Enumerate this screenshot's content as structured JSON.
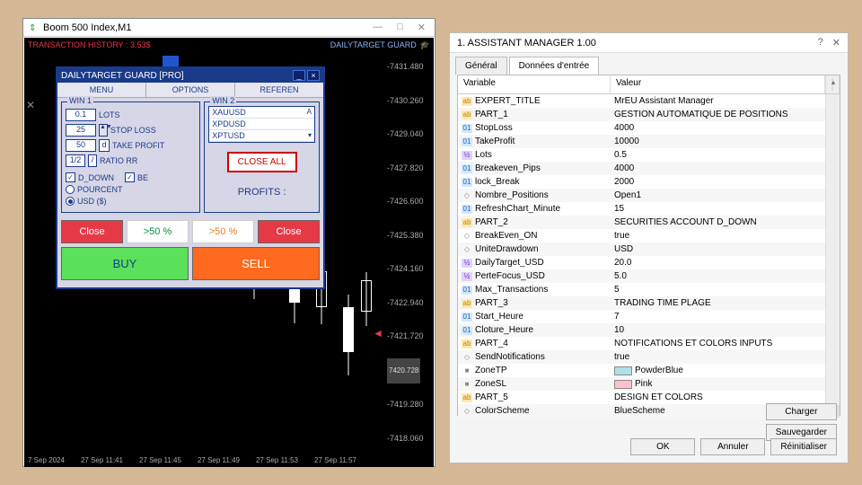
{
  "left": {
    "title": "Boom 500 Index,M1",
    "win_min": "—",
    "win_max": "□",
    "win_close": "✕",
    "history": "TRANSACTION HISTORY : 3.53$",
    "guard": "DAILYTARGET GUARD",
    "y_ticks": [
      "-7431.480",
      "-7430.260",
      "-7429.040",
      "-7427.820",
      "-7426.600",
      "-7425.380",
      "-7424.160",
      "-7422.940",
      "-7421.720",
      "7420.728",
      "-7419.280",
      "-7418.060"
    ],
    "x_ticks": [
      "7 Sep 2024",
      "27 Sep 11:41",
      "27 Sep 11:45",
      "27 Sep 11:49",
      "27 Sep 11:53",
      "27 Sep 11:57"
    ]
  },
  "panel": {
    "title": "DAILYTARGET GUARD [PRO]",
    "menu": [
      "MENU",
      "OPTIONS",
      "REFEREN"
    ],
    "win1": {
      "legend": "WIN 1",
      "lots_val": "0.1",
      "lots_lbl": "LOTS",
      "sl_val": "25",
      "sl_lbl": "STOP LOSS",
      "tp_val": "50",
      "tp_unit": "d",
      "tp_lbl": "TAKE PROFIT",
      "rr_val": "1/2",
      "rr_slash": "/",
      "rr_lbl": "RATIO RR",
      "chk_ddown": "D_DOWN",
      "chk_be": "BE",
      "rad_pc": "POURCENT",
      "rad_usd": "USD ($)"
    },
    "win2": {
      "legend": "WIN 2",
      "symbols": [
        "XAUUSD",
        "XPDUSD",
        "XPTUSD"
      ],
      "close_all": "CLOSE ALL",
      "profits": "PROFITS :"
    },
    "btns": {
      "close": "Close",
      "gt50": ">50 %",
      "gt50b": ">50 %",
      "close2": "Close",
      "buy": "BUY",
      "sell": "SELL"
    }
  },
  "right": {
    "title": "1. ASSISTANT MANAGER 1.00",
    "tabs": [
      "Général",
      "Données d'entrée"
    ],
    "cols": [
      "Variable",
      "Valeur"
    ],
    "rows": [
      {
        "t": "ab",
        "k": "EXPERT_TITLE",
        "v": "MrEU Assistant Manager"
      },
      {
        "t": "ab",
        "k": "PART_1",
        "v": "GESTION AUTOMATIQUE DE POSITIONS"
      },
      {
        "t": "01",
        "k": "StopLoss",
        "v": "4000"
      },
      {
        "t": "01",
        "k": "TakeProfit",
        "v": "10000"
      },
      {
        "t": "half",
        "k": "Lots",
        "v": "0.5"
      },
      {
        "t": "01",
        "k": "Breakeven_Pips",
        "v": "4000"
      },
      {
        "t": "01",
        "k": "lock_Break",
        "v": "2000"
      },
      {
        "t": "circle",
        "k": "Nombre_Positions",
        "v": "Open1"
      },
      {
        "t": "01",
        "k": "RefreshChart_Minute",
        "v": "15"
      },
      {
        "t": "ab",
        "k": "PART_2",
        "v": "SECURITIES ACCOUNT D_DOWN"
      },
      {
        "t": "circle",
        "k": "BreakEven_ON",
        "v": "true"
      },
      {
        "t": "circle",
        "k": "UniteDrawdown",
        "v": "USD"
      },
      {
        "t": "half",
        "k": "DailyTarget_USD",
        "v": "20.0"
      },
      {
        "t": "half",
        "k": "PerteFocus_USD",
        "v": "5.0"
      },
      {
        "t": "01",
        "k": "Max_Transactions",
        "v": "5"
      },
      {
        "t": "ab",
        "k": "PART_3",
        "v": "TRADING TIME PLAGE"
      },
      {
        "t": "01",
        "k": "Start_Heure",
        "v": "7"
      },
      {
        "t": "01",
        "k": "Cloture_Heure",
        "v": "10"
      },
      {
        "t": "ab",
        "k": "PART_4",
        "v": "NOTIFICATIONS ET COLORS INPUTS"
      },
      {
        "t": "circle",
        "k": "SendNotifications",
        "v": "true"
      },
      {
        "t": "color",
        "k": "ZoneTP",
        "v": "PowderBlue",
        "c": "#b0e0e6"
      },
      {
        "t": "color",
        "k": "ZoneSL",
        "v": "Pink",
        "c": "#ffc0cb"
      },
      {
        "t": "ab",
        "k": "PART_5",
        "v": "DESIGN ET COLORS"
      },
      {
        "t": "circle",
        "k": "ColorScheme",
        "v": "BlueScheme"
      }
    ],
    "btn_load": "Charger",
    "btn_save": "Sauvegarder",
    "btn_ok": "OK",
    "btn_cancel": "Annuler",
    "btn_reset": "Réinitialiser"
  }
}
